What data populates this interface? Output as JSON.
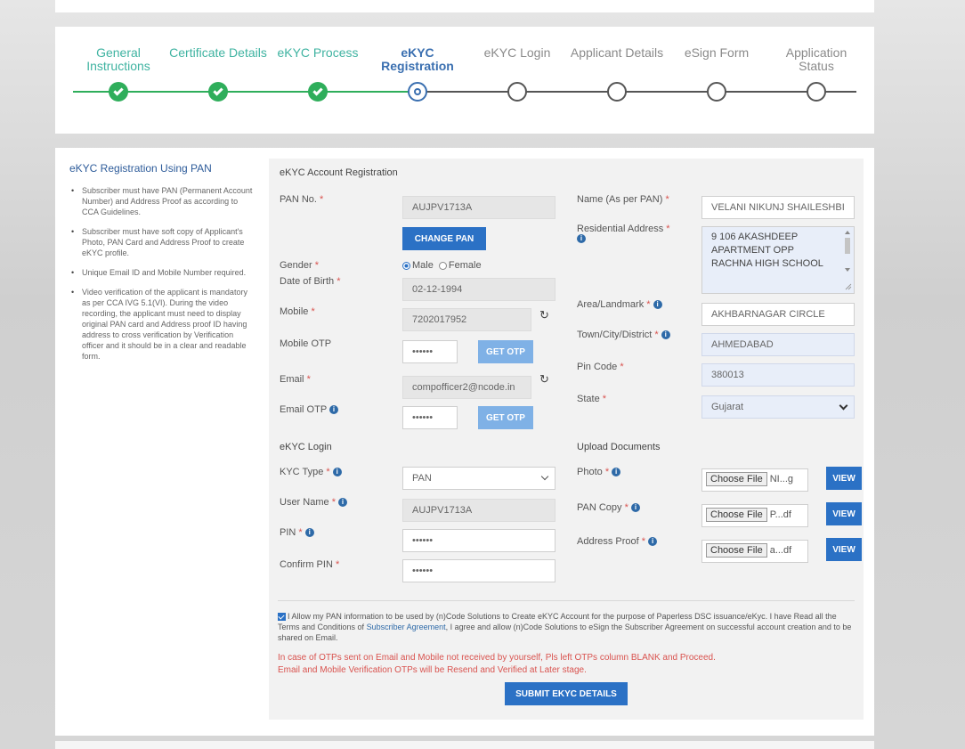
{
  "stepper": {
    "steps": [
      {
        "label": "General Instructions",
        "state": "done"
      },
      {
        "label": "Certificate Details",
        "state": "done"
      },
      {
        "label": "eKYC Process",
        "state": "done"
      },
      {
        "label": "eKYC Registration",
        "state": "active"
      },
      {
        "label": "eKYC Login",
        "state": "todo"
      },
      {
        "label": "Applicant Details",
        "state": "todo"
      },
      {
        "label": "eSign Form",
        "state": "todo"
      },
      {
        "label": "Application Status",
        "state": "todo"
      }
    ],
    "colors": {
      "done": "#2fae5b",
      "active": "#3a6fb0",
      "todo": "#555555"
    }
  },
  "sidebar": {
    "title": "eKYC Registration Using PAN",
    "items": [
      "Subscriber must have PAN (Permanent Account Number) and Address Proof as according to CCA Guidelines.",
      "Subscriber must have soft copy of Applicant's Photo, PAN Card and Address Proof to create eKYC profile.",
      "Unique Email ID and Mobile Number required.",
      "Video verification of the applicant is mandatory as per CCA IVG 5.1(VI). During the video recording, the applicant must need to display original PAN card and Address proof ID having address to cross verification by Verification officer and it should be in a clear and readable form."
    ]
  },
  "registration": {
    "section_title": "eKYC Account Registration",
    "pan_label": "PAN No.",
    "pan_value": "AUJPV1713A",
    "change_pan_label": "CHANGE PAN",
    "name_label": "Name (As per PAN)",
    "name_value": "VELANI NIKUNJ SHAILESHBI",
    "address_label": "Residential Address",
    "address_value": "9 106 AKASHDEEP APARTMENT OPP RACHNA HIGH SCHOOL",
    "gender_label": "Gender",
    "gender_male": "Male",
    "gender_female": "Female",
    "dob_label": "Date of Birth",
    "dob_value": "02-12-1994",
    "mobile_label": "Mobile",
    "mobile_value": "7202017952",
    "mobile_otp_label": "Mobile OTP",
    "mobile_otp_value": "••••••",
    "get_otp_label": "GET OTP",
    "email_label": "Email",
    "email_value": "compofficer2@ncode.in",
    "email_otp_label": "Email OTP",
    "email_otp_value": "••••••",
    "area_label": "Area/Landmark",
    "area_value": "AKHBARNAGAR CIRCLE",
    "town_label": "Town/City/District",
    "town_value": "AHMEDABAD",
    "pin_label": "Pin Code",
    "pin_value": "380013",
    "state_label": "State",
    "state_value": "Gujarat"
  },
  "login": {
    "section_title": "eKYC Login",
    "kyc_type_label": "KYC Type",
    "kyc_type_value": "PAN",
    "username_label": "User Name",
    "username_value": "AUJPV1713A",
    "pin_label": "PIN",
    "pin_value": "••••••",
    "confirm_pin_label": "Confirm PIN",
    "confirm_pin_value": "••••••"
  },
  "uploads": {
    "section_title": "Upload Documents",
    "choose_file_label": "Choose File",
    "view_label": "VIEW",
    "items": [
      {
        "label": "Photo",
        "file": "NI...g"
      },
      {
        "label": "PAN Copy",
        "file": "P...df"
      },
      {
        "label": "Address Proof",
        "file": "a...df"
      }
    ]
  },
  "consent": {
    "text_before": "I Allow my PAN information to be used by (n)Code Solutions to Create eKYC Account for the purpose of Paperless DSC issuance/eKyc. I have Read all the Terms and Conditions of ",
    "link_text": "Subscriber Agreement",
    "text_after": ", I agree and allow (n)Code Solutions to eSign the Subscriber Agreement on successful account creation and to be shared on Email.",
    "warning_1": "In case of OTPs sent on Email and Mobile not received by yourself, Pls left OTPs column BLANK and Proceed.",
    "warning_2": "Email and Mobile Verification OTPs will be Resend and Verified at Later stage.",
    "submit_label": "SUBMIT EKYC DETAILS"
  },
  "icons": {
    "refresh": "↻",
    "info": "i",
    "required": "*"
  }
}
